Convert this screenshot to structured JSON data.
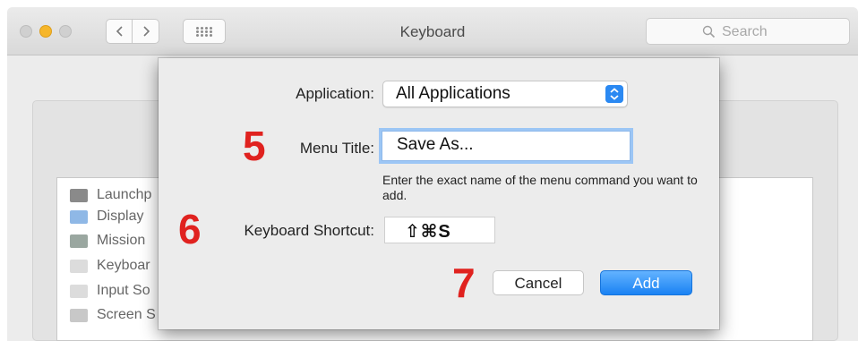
{
  "window": {
    "title": "Keyboard",
    "search": {
      "placeholder": "Search"
    }
  },
  "background_list": {
    "items": [
      {
        "label": "Launchp",
        "icon": "launchpad-icon",
        "color": "#8a8a8a"
      },
      {
        "label": "Display",
        "icon": "display-icon",
        "color": "#8fb8e6"
      },
      {
        "label": "Mission",
        "icon": "mission-control-icon",
        "color": "#9aa7a0"
      },
      {
        "label": "Keyboar",
        "icon": "keyboard-icon",
        "color": "#dcdcdc"
      },
      {
        "label": "Input So",
        "icon": "input-sources-icon",
        "color": "#dcdcdc"
      },
      {
        "label": "Screen S",
        "icon": "screen-shot-icon",
        "color": "#c8c8c8"
      }
    ]
  },
  "dialog": {
    "application": {
      "label": "Application:",
      "value": "All Applications"
    },
    "menu_title": {
      "label": "Menu Title:",
      "value": "Save As..."
    },
    "help_text": "Enter the exact name of the menu command you want to add.",
    "shortcut": {
      "label": "Keyboard Shortcut:",
      "value": "⇧⌘S"
    },
    "buttons": {
      "cancel": "Cancel",
      "add": "Add"
    }
  },
  "annotations": {
    "step5": "5",
    "step6": "6",
    "step7": "7"
  },
  "colors": {
    "accent": "#1a82f3",
    "annotation": "#e0221f",
    "traffic_yellow": "#f6b62a"
  }
}
